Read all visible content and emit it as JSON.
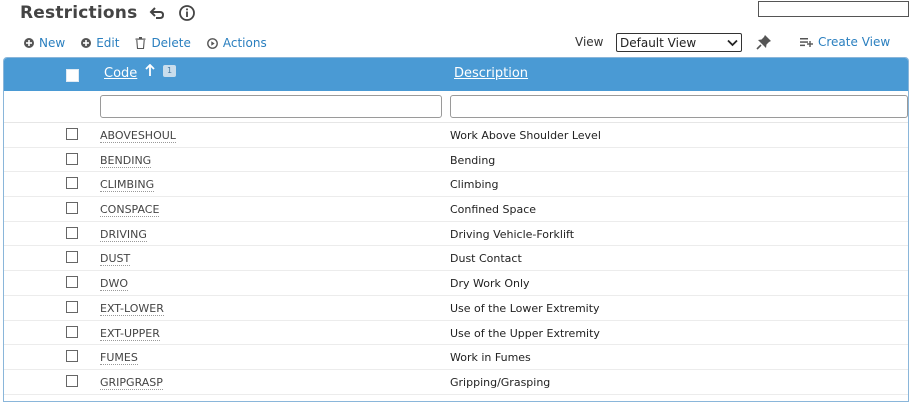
{
  "page": {
    "title": "Restrictions",
    "search_value": ""
  },
  "toolbar": {
    "new_label": "New",
    "edit_label": "Edit",
    "delete_label": "Delete",
    "actions_label": "Actions",
    "view_label": "View",
    "view_selected": "Default View",
    "create_view_label": "Create View"
  },
  "grid": {
    "columns": {
      "code": "Code",
      "description": "Description",
      "sort_order_badge": "1"
    },
    "filters": {
      "code_value": "",
      "description_value": ""
    },
    "rows": [
      {
        "code": "ABOVESHOUL",
        "description": "Work Above Shoulder Level"
      },
      {
        "code": "BENDING",
        "description": "Bending"
      },
      {
        "code": "CLIMBING",
        "description": "Climbing"
      },
      {
        "code": "CONSPACE",
        "description": "Confined Space"
      },
      {
        "code": "DRIVING",
        "description": "Driving Vehicle-Forklift"
      },
      {
        "code": "DUST",
        "description": "Dust Contact"
      },
      {
        "code": "DWO",
        "description": "Dry Work Only"
      },
      {
        "code": "EXT-LOWER",
        "description": "Use of the Lower Extremity"
      },
      {
        "code": "EXT-UPPER",
        "description": "Use of the Upper Extremity"
      },
      {
        "code": "FUMES",
        "description": "Work in Fumes"
      },
      {
        "code": "GRIPGRASP",
        "description": "Gripping/Grasping"
      }
    ]
  },
  "icons": {
    "back": "back-arrow-icon",
    "info": "info-icon",
    "new": "plus-circle-icon",
    "edit": "plus-circle-icon",
    "delete": "trash-icon",
    "actions": "play-circle-icon",
    "pin": "pin-icon",
    "create_view": "list-add-icon",
    "sort": "sort-up-arrow-icon",
    "dropdown": "chevron-down-icon"
  },
  "colors": {
    "header_bg": "#4a9ad4",
    "link": "#2a7fbf",
    "title": "#444444"
  }
}
